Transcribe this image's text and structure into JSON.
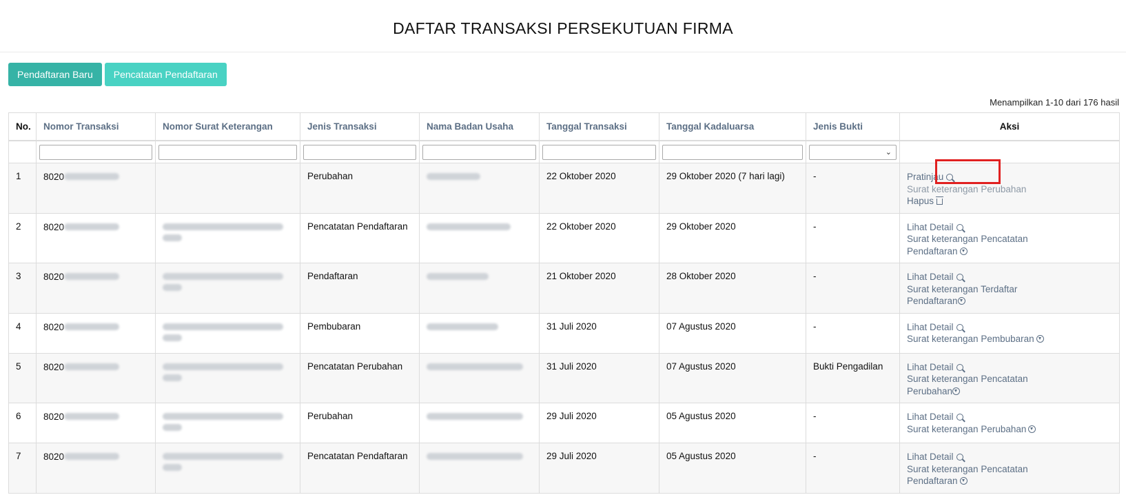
{
  "page": {
    "title": "DAFTAR TRANSAKSI PERSEKUTUAN FIRMA"
  },
  "toolbar": {
    "new_registration_label": "Pendaftaran Baru",
    "registration_record_label": "Pencatatan Pendaftaran"
  },
  "summary": "Menampilkan 1-10 dari 176 hasil",
  "table": {
    "headers": {
      "no": "No.",
      "nomor_transaksi": "Nomor Transaksi",
      "nomor_surat": "Nomor Surat Keterangan",
      "jenis_transaksi": "Jenis Transaksi",
      "nama_badan_usaha": "Nama Badan Usaha",
      "tanggal_transaksi": "Tanggal Transaksi",
      "tanggal_kadaluarsa": "Tanggal Kadaluarsa",
      "jenis_bukti": "Jenis Bukti",
      "aksi": "Aksi"
    },
    "rows": [
      {
        "no": "1",
        "nomor_prefix": "8020",
        "jenis_transaksi": "Perubahan",
        "tanggal_transaksi": "22 Oktober 2020",
        "tanggal_kadaluarsa": "29 Oktober 2020 (7 hari lagi)",
        "jenis_bukti": "-",
        "action_primary": "Pratinjau",
        "action_doc": "Surat keterangan Perubahan",
        "action_delete": "Hapus"
      },
      {
        "no": "2",
        "nomor_prefix": "8020",
        "jenis_transaksi": "Pencatatan Pendaftaran",
        "tanggal_transaksi": "22 Oktober 2020",
        "tanggal_kadaluarsa": "29 Oktober 2020",
        "jenis_bukti": "-",
        "action_primary": "Lihat Detail",
        "action_doc": "Surat keterangan Pencatatan Pendaftaran"
      },
      {
        "no": "3",
        "nomor_prefix": "8020",
        "jenis_transaksi": "Pendaftaran",
        "tanggal_transaksi": "21 Oktober 2020",
        "tanggal_kadaluarsa": "28 Oktober 2020",
        "jenis_bukti": "-",
        "action_primary": "Lihat Detail",
        "action_doc": "Surat keterangan Terdaftar Pendaftaran"
      },
      {
        "no": "4",
        "nomor_prefix": "8020",
        "jenis_transaksi": "Pembubaran",
        "tanggal_transaksi": "31 Juli 2020",
        "tanggal_kadaluarsa": "07 Agustus 2020",
        "jenis_bukti": "-",
        "action_primary": "Lihat Detail",
        "action_doc": "Surat keterangan Pembubaran"
      },
      {
        "no": "5",
        "nomor_prefix": "8020",
        "jenis_transaksi": "Pencatatan Perubahan",
        "tanggal_transaksi": "31 Juli 2020",
        "tanggal_kadaluarsa": "07 Agustus 2020",
        "jenis_bukti": "Bukti Pengadilan",
        "action_primary": "Lihat Detail",
        "action_doc": "Surat keterangan Pencatatan Perubahan"
      },
      {
        "no": "6",
        "nomor_prefix": "8020",
        "jenis_transaksi": "Perubahan",
        "tanggal_transaksi": "29 Juli 2020",
        "tanggal_kadaluarsa": "05 Agustus 2020",
        "jenis_bukti": "-",
        "action_primary": "Lihat Detail",
        "action_doc": "Surat keterangan Perubahan"
      },
      {
        "no": "7",
        "nomor_prefix": "8020",
        "jenis_transaksi": "Pencatatan Pendaftaran",
        "tanggal_transaksi": "29 Juli 2020",
        "tanggal_kadaluarsa": "05 Agustus 2020",
        "jenis_bukti": "-",
        "action_primary": "Lihat Detail",
        "action_doc": "Surat keterangan Pencatatan Pendaftaran"
      }
    ]
  },
  "icons": {
    "preview": "search-icon",
    "detail": "search-icon",
    "download": "download-icon",
    "delete": "trash-icon",
    "filter_select": "chevron-down-icon"
  },
  "colors": {
    "primary_button": "#36b3a6",
    "secondary_button": "#49d2c3",
    "header_text": "#5c6f85",
    "expiry_warning": "#e0312d",
    "highlight": "#e02020"
  }
}
